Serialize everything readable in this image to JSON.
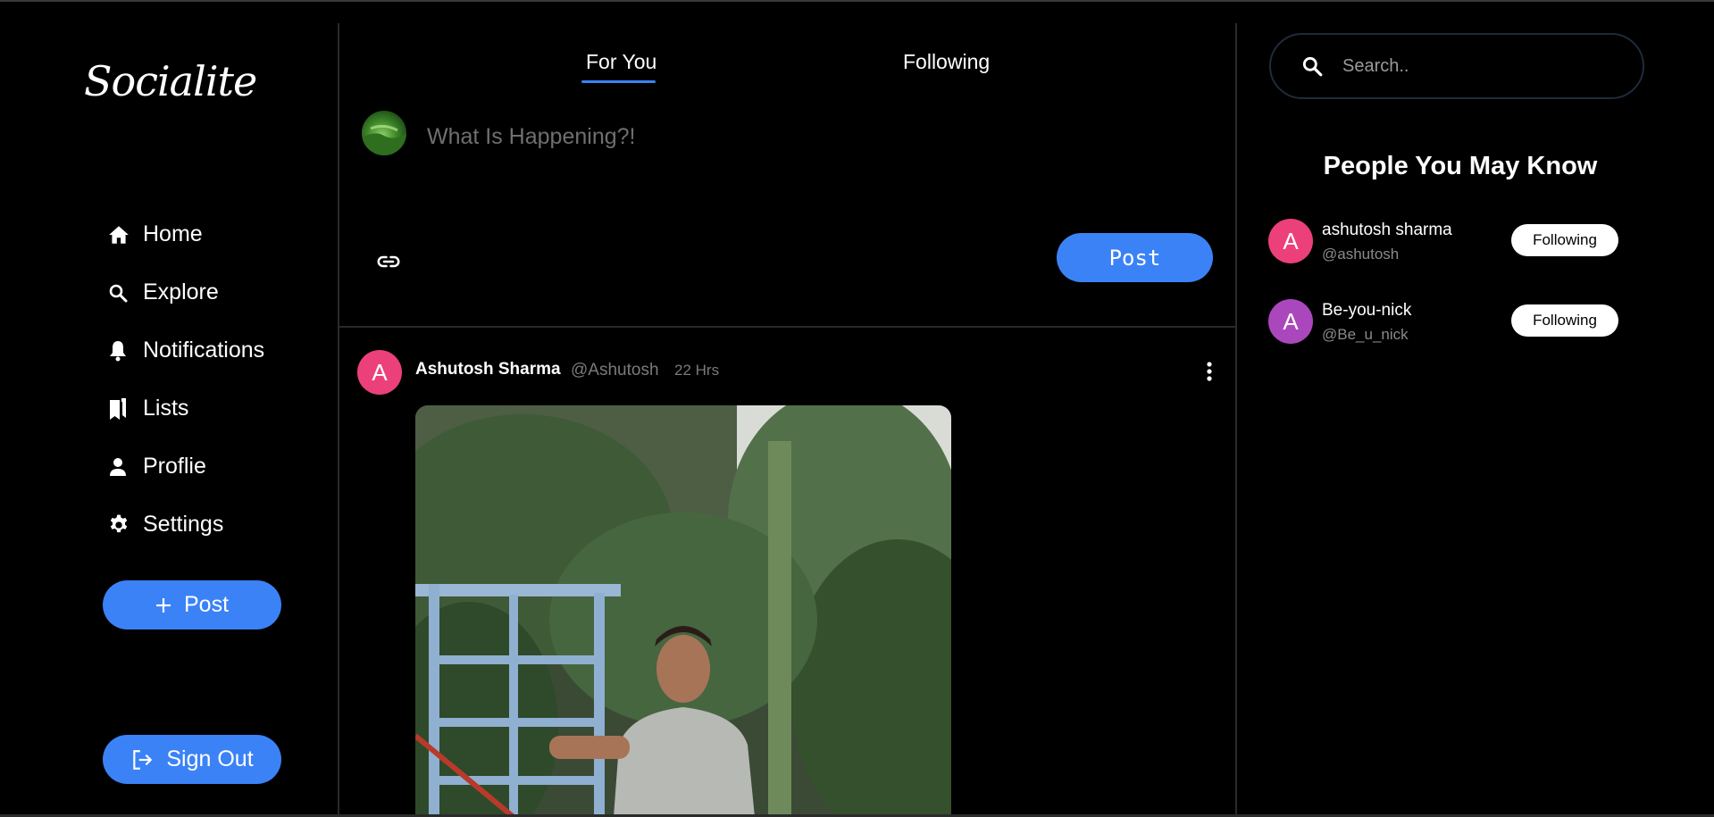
{
  "app": {
    "logo": "Socialite"
  },
  "sidebar": {
    "items": [
      {
        "label": "Home",
        "icon": "home-icon"
      },
      {
        "label": "Explore",
        "icon": "search-icon"
      },
      {
        "label": "Notifications",
        "icon": "bell-icon"
      },
      {
        "label": "Lists",
        "icon": "bookmarks-icon"
      },
      {
        "label": "Proflie",
        "icon": "person-icon"
      },
      {
        "label": "Settings",
        "icon": "gear-icon"
      }
    ],
    "post_button": "Post",
    "signout_button": "Sign Out"
  },
  "feed": {
    "tabs": [
      {
        "label": "For You",
        "active": true
      },
      {
        "label": "Following",
        "active": false
      }
    ],
    "composer": {
      "placeholder": "What Is Happening?!",
      "post_button": "Post"
    },
    "post": {
      "avatar_letter": "A",
      "name": "Ashutosh Sharma",
      "handle": "@Ashutosh",
      "time": "22 Hrs"
    }
  },
  "right": {
    "search_placeholder": "Search..",
    "pymk_title": "People You May Know",
    "people": [
      {
        "letter": "A",
        "name": "ashutosh sharma",
        "handle": "@ashutosh",
        "button": "Following",
        "color": "#ec407a"
      },
      {
        "letter": "A",
        "name": "Be-you-nick",
        "handle": "@Be_u_nick",
        "button": "Following",
        "color": "#ab47bc"
      }
    ]
  },
  "colors": {
    "accent": "#3b82f6",
    "background": "#000000"
  }
}
